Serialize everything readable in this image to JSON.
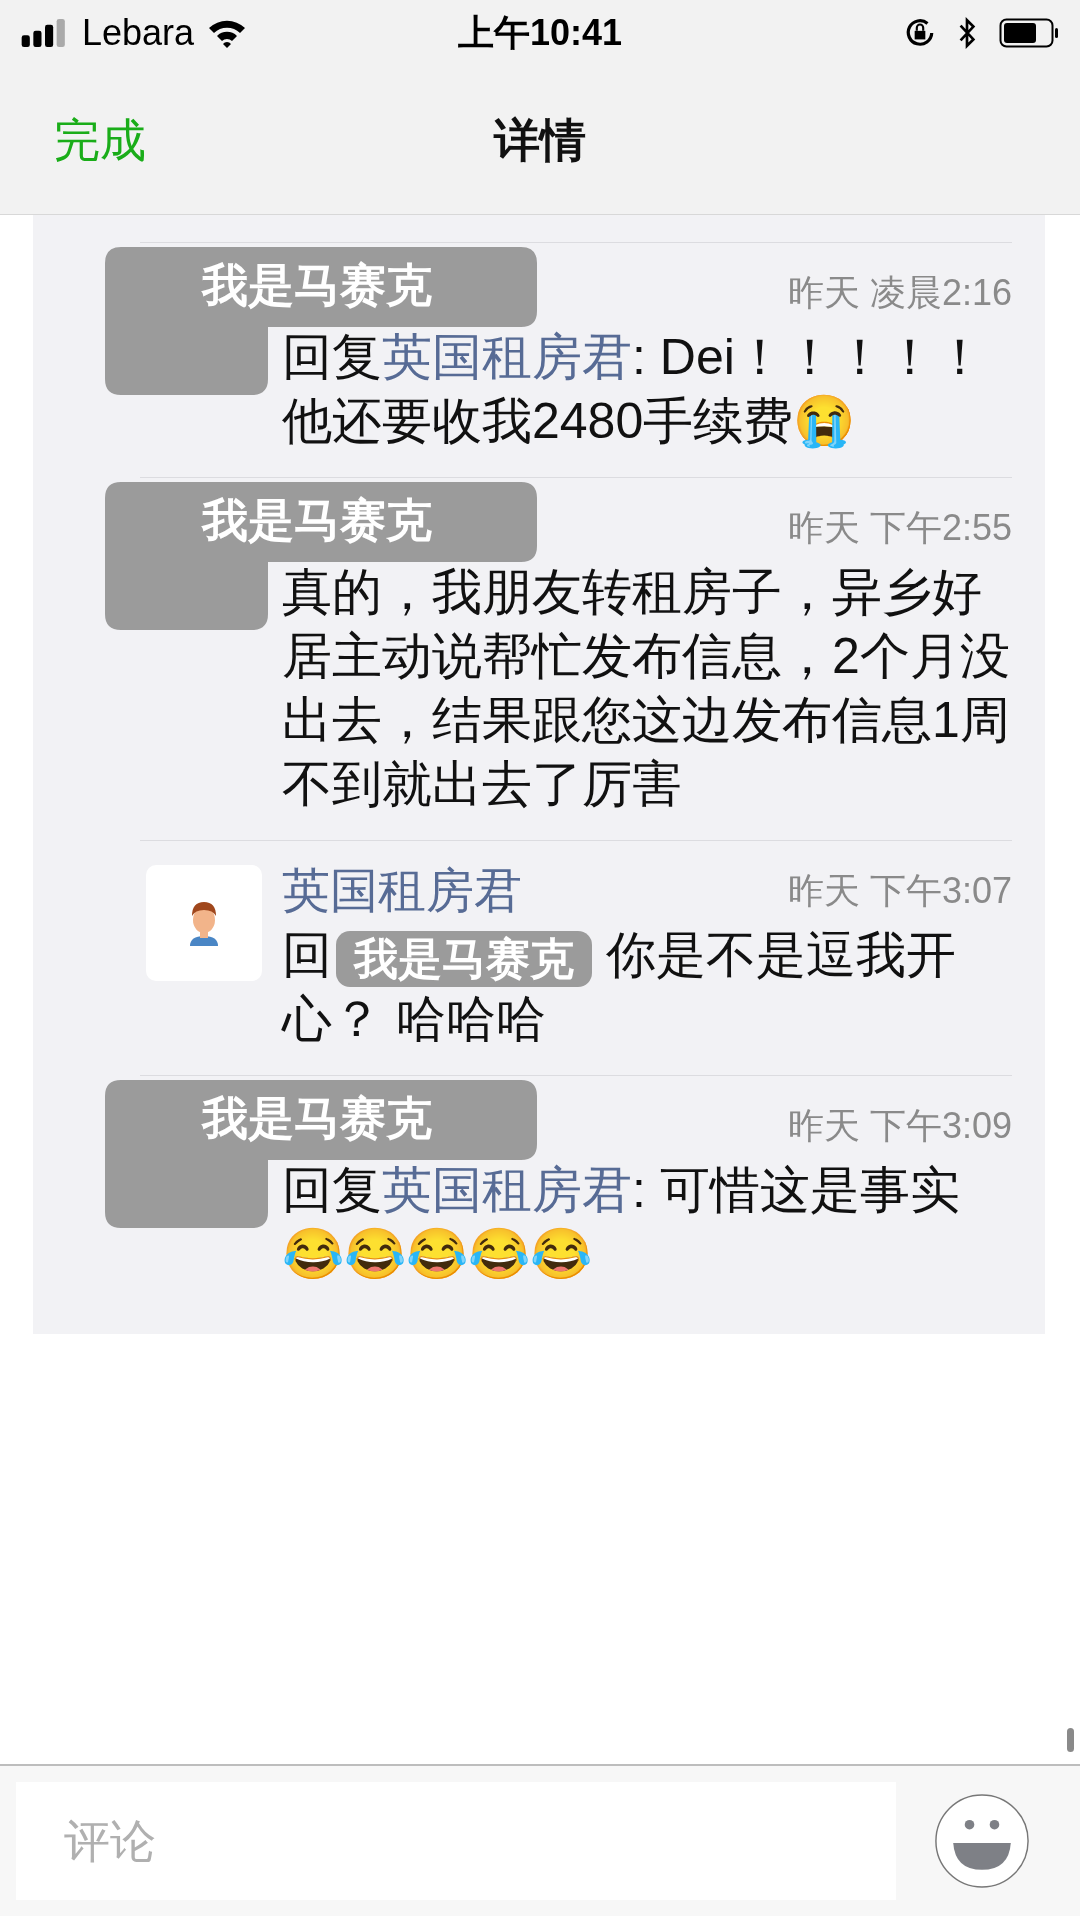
{
  "status_bar": {
    "carrier": "Lebara",
    "time": "上午10:41"
  },
  "nav": {
    "done": "完成",
    "title": "详情"
  },
  "comments": [
    {
      "kind": "redacted",
      "redaction": "我是马赛克",
      "time": "昨天 凌晨2:16",
      "reply_prefix": "回复",
      "reply_to": "英国租房君",
      "text": ": Dei！！！！！他还要收我2480手续费😭"
    },
    {
      "kind": "redacted",
      "redaction": "我是马赛克",
      "time": "昨天 下午2:55",
      "text": "真的，我朋友转租房子，异乡好居主动说帮忙发布信息，2个月没出去，结果跟您这边发布信息1周不到就出去了厉害"
    },
    {
      "kind": "named",
      "author": "英国租房君",
      "time": "昨天 下午3:07",
      "lead": "回",
      "redaction": "我是马赛克",
      "text": "你是不是逗我开心？ 哈哈哈"
    },
    {
      "kind": "redacted",
      "redaction": "我是马赛克",
      "time": "昨天 下午3:09",
      "reply_prefix": "回复",
      "reply_to": "英国租房君",
      "text": ": 可惜这是事实\n😂😂😂😂😂"
    }
  ],
  "composer": {
    "placeholder": "评论"
  }
}
